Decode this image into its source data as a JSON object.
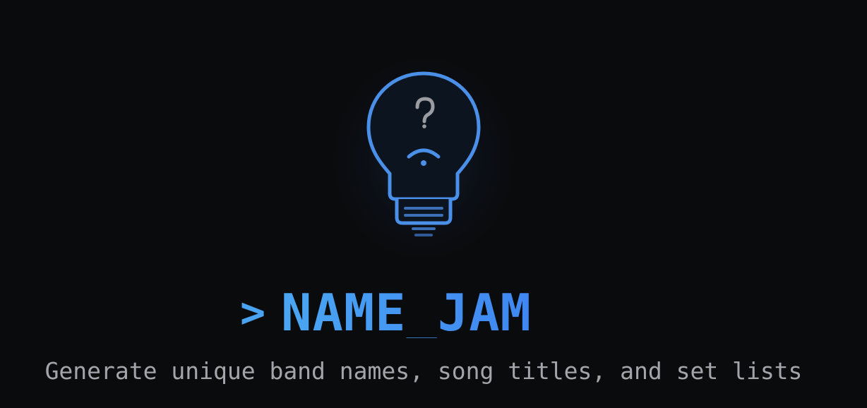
{
  "hero": {
    "icon": "lightbulb-question-icon",
    "prompt_symbol": ">",
    "title": "NAME_JAM",
    "subtitle": "Generate unique band names, song titles, and set lists"
  },
  "colors": {
    "background": "#0a0b0d",
    "accent_blue": "#4a90e8",
    "prompt_blue": "#4aa3f0",
    "subtitle_gray": "#a3a5ab",
    "question_mark_gray": "#9a9ca2"
  }
}
